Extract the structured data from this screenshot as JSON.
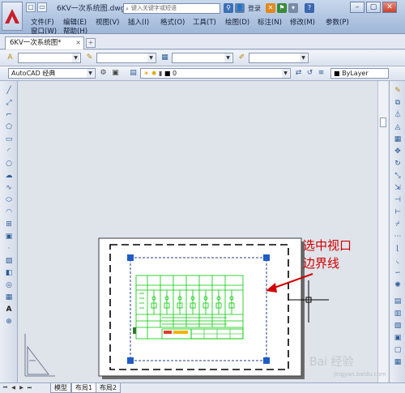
{
  "titlebar": {
    "doc_title": "6KV一次系统图.dwg",
    "search_placeholder": "键入关键字或短语",
    "login_label": "登录"
  },
  "menu": {
    "items": [
      "文件(F)",
      "编辑(E)",
      "视图(V)",
      "插入(I)",
      "格式(O)",
      "工具(T)",
      "绘图(D)",
      "标注(N)",
      "修改(M)",
      "参数(P)",
      "窗口(W)",
      "帮助(H)"
    ]
  },
  "tabs": {
    "document_tab": "6KV一次系统图*"
  },
  "toolbar": {
    "workspace": "AutoCAD 经典",
    "layer_value": "0",
    "color_value": "ByLayer"
  },
  "layout_tabs": [
    "模型",
    "布局1",
    "布局2"
  ],
  "annotation": {
    "line1": "选中视口",
    "line2": "边界线"
  },
  "watermark": {
    "text": "Bai 经验",
    "url": "jingyan.baidu.com"
  },
  "colors": {
    "annotation": "#d10000",
    "grip": "#1f5cc4",
    "drawing_green": "#00d000",
    "app_logo_red": "#c8202b"
  }
}
